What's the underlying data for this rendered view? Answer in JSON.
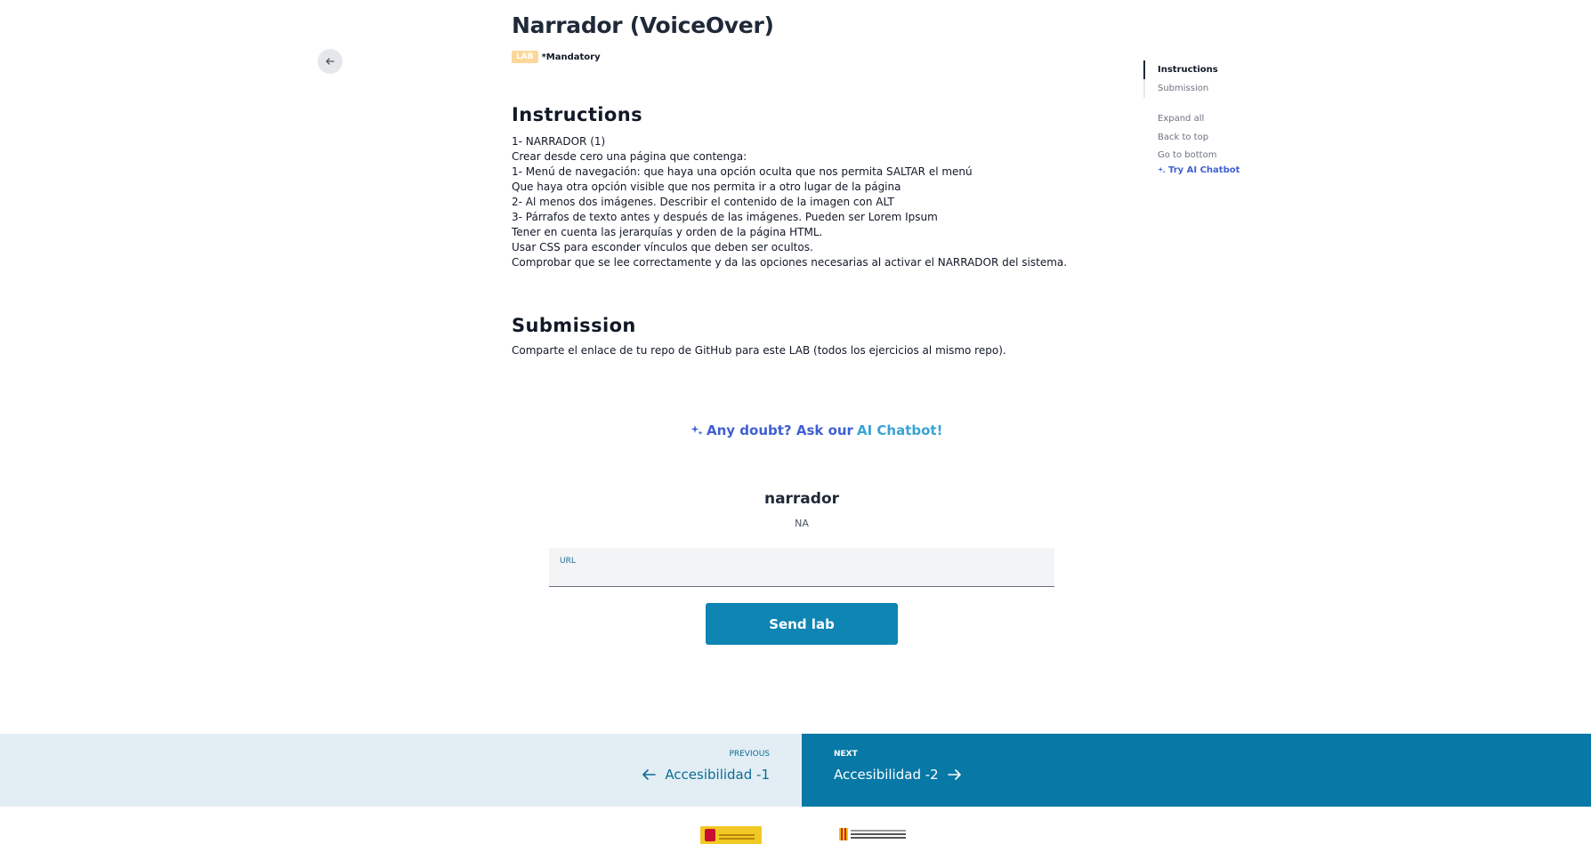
{
  "header": {
    "title": "Narrador (VoiceOver)",
    "badge": "LAB",
    "mandatory": "*Mandatory"
  },
  "instructions": {
    "title": "Instructions",
    "lines": [
      "1- NARRADOR (1)",
      "Crear desde cero una página que contenga:",
      "1- Menú de navegación: que haya una opción oculta que nos permita SALTAR el menú",
      "Que haya otra opción visible que nos permita ir a otro lugar de la página",
      "2- Al menos dos imágenes. Describir el contenido de la imagen con ALT",
      "3- Párrafos de texto antes y después de las imágenes. Pueden ser Lorem Ipsum",
      "Tener en cuenta las jerarquías y orden de la página HTML.",
      "Usar CSS para esconder vínculos que deben ser ocultos.",
      "Comprobar que se lee correctamente y da las opciones necesarias al activar el NARRADOR del sistema."
    ]
  },
  "submission": {
    "title": "Submission",
    "text": "Comparte el enlace de tu repo de GitHub para este LAB (todos los ejercicios al mismo repo)."
  },
  "chatbot": {
    "prefix": "Any doubt? Ask our",
    "highlight": "AI Chatbot!"
  },
  "lab_form": {
    "name": "narrador",
    "status": "NA",
    "url_label": "URL",
    "url_value": "",
    "send_label": "Send lab"
  },
  "toc": {
    "items": [
      {
        "label": "Instructions",
        "active": true
      },
      {
        "label": "Submission",
        "active": false
      }
    ],
    "expand_all": "Expand all",
    "back_to_top": "Back to top",
    "go_to_bottom": "Go to bottom",
    "try_chatbot": "Try AI Chatbot"
  },
  "pager": {
    "prev_kicker": "PREVIOUS",
    "prev_title": "Accesibilidad -1",
    "next_kicker": "NEXT",
    "next_title": "Accesibilidad -2"
  },
  "colors": {
    "accent": "#0e85b3",
    "next_bg": "#0878a6",
    "prev_bg": "#e2eef4",
    "chatbot": "#3f5fd0",
    "badge": "#fcd79a"
  },
  "icons": {
    "back": "arrow-left-icon",
    "sparkle": "sparkle-icon",
    "prev": "arrow-left-icon",
    "next": "arrow-right-icon"
  }
}
